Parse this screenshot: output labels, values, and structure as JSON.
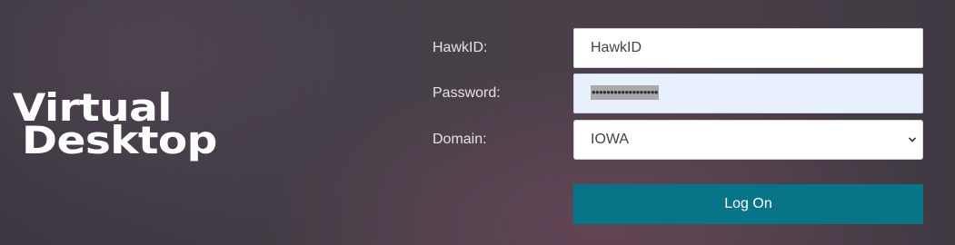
{
  "logo": {
    "line1": "Virtual",
    "line2": "Desktop"
  },
  "form": {
    "hawkid": {
      "label": "HawkID:",
      "value": "HawkID"
    },
    "password": {
      "label": "Password:",
      "masked_value": "••••••••••••••••••"
    },
    "domain": {
      "label": "Domain:",
      "selected": "IOWA"
    },
    "logon_label": "Log On"
  },
  "colors": {
    "button": "#087488",
    "autofill_bg": "#e8f0fe",
    "text_light": "#e4e1e6"
  },
  "icons": {
    "select_arrow": "chevron-down-icon"
  }
}
